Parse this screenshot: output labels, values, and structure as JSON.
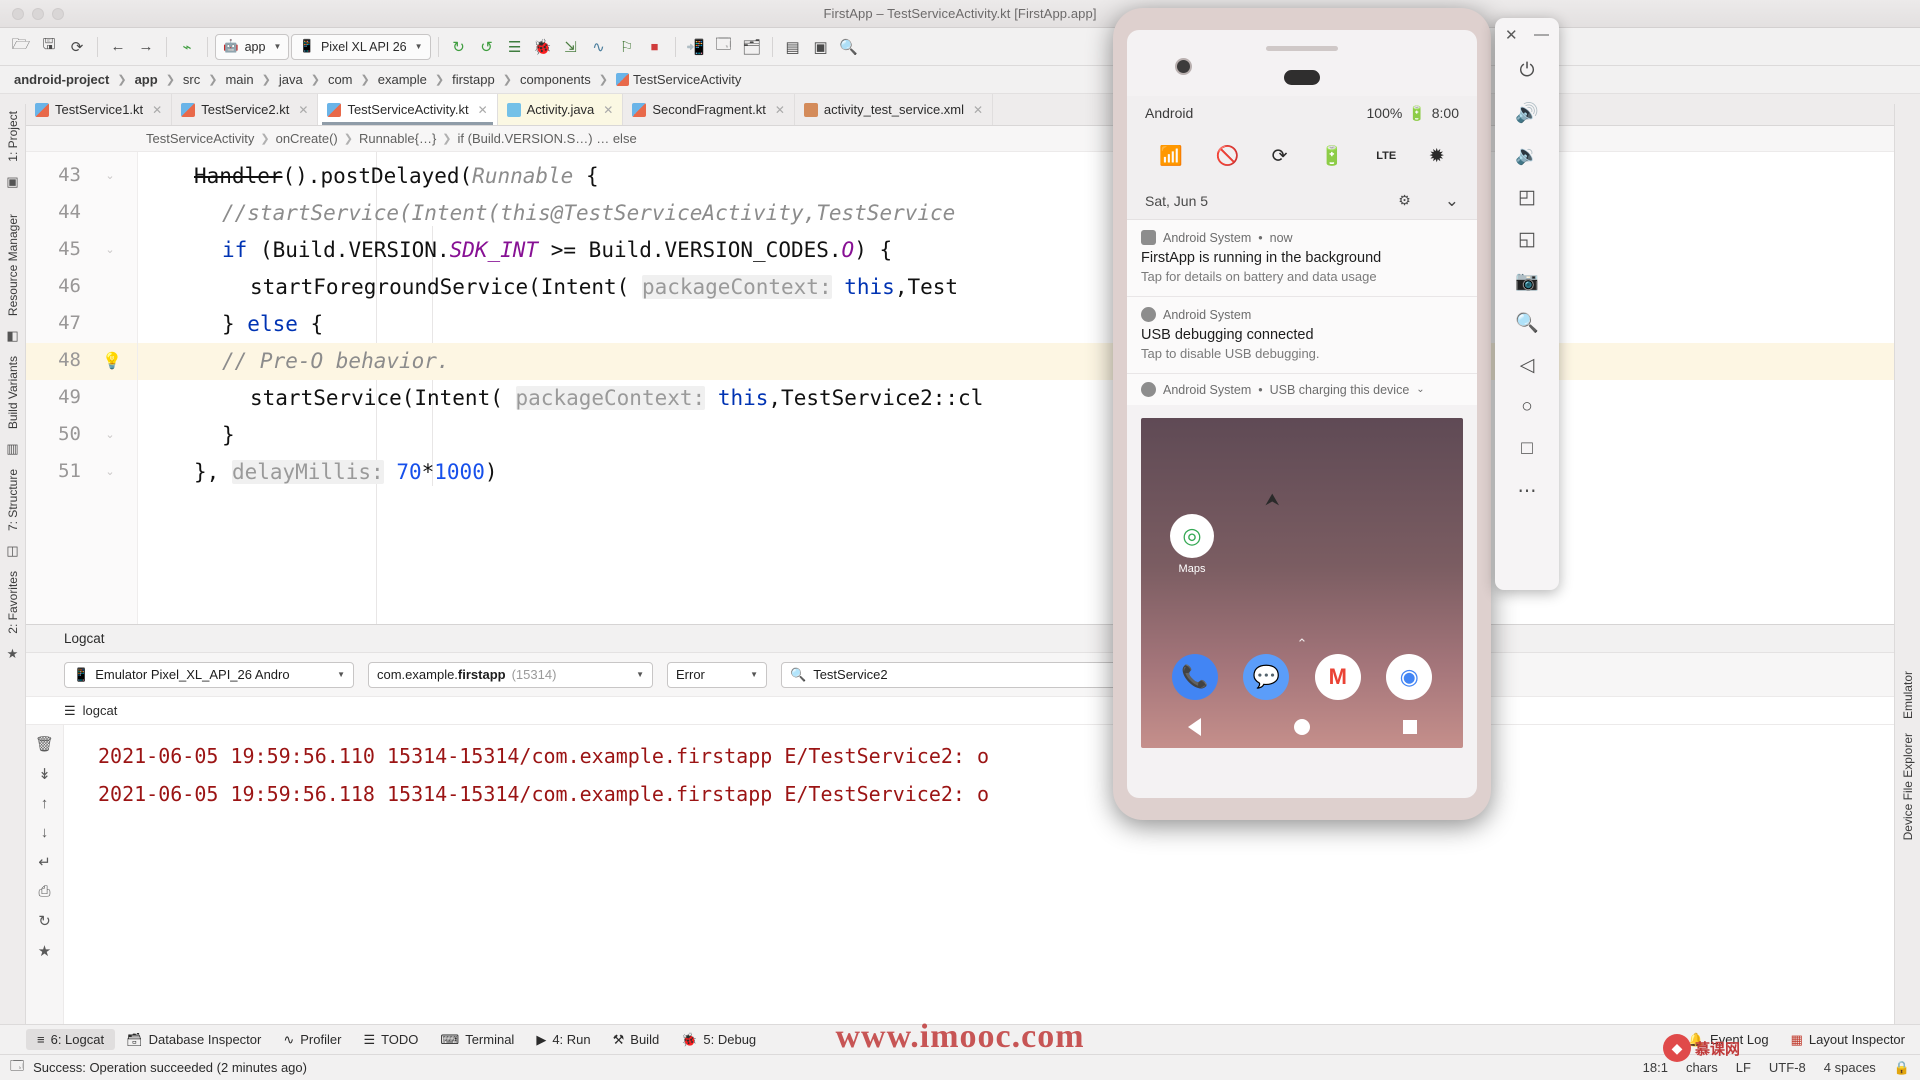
{
  "window": {
    "title": "FirstApp – TestServiceActivity.kt [FirstApp.app]"
  },
  "toolbar": {
    "icons": [
      {
        "name": "open-folder-icon",
        "glyph": "📂"
      },
      {
        "name": "save-all-icon",
        "glyph": "💾"
      },
      {
        "name": "sync-icon",
        "glyph": "↻"
      },
      {
        "name": "back-icon",
        "glyph": "←"
      },
      {
        "name": "forward-icon",
        "glyph": "→"
      },
      {
        "name": "build-hammer-icon",
        "glyph": "⚒"
      }
    ],
    "module_selector": "app",
    "device_selector": "Pixel XL API 26",
    "run_icons": [
      {
        "name": "run-icon",
        "glyph": "▶"
      },
      {
        "name": "apply-changes-icon",
        "glyph": "↻"
      },
      {
        "name": "apply-code-changes-icon",
        "glyph": "↺"
      },
      {
        "name": "run-with-coverage-icon",
        "glyph": "≡"
      },
      {
        "name": "debug-icon",
        "glyph": "🐞"
      },
      {
        "name": "attach-debugger-icon",
        "glyph": "⬇"
      },
      {
        "name": "profile-icon",
        "glyph": "∿"
      },
      {
        "name": "run-anything-icon",
        "glyph": "⚑"
      },
      {
        "name": "stop-icon",
        "glyph": "■"
      },
      {
        "name": "avd-manager-icon",
        "glyph": "📱"
      },
      {
        "name": "sdk-manager-icon",
        "glyph": "⚙"
      },
      {
        "name": "device-file-explorer-icon",
        "glyph": "🗂"
      },
      {
        "name": "layout-inspector-icon",
        "glyph": "▦"
      },
      {
        "name": "search-everywhere-icon",
        "glyph": "🔍"
      }
    ]
  },
  "breadcrumb": {
    "items": [
      {
        "label": "android-project",
        "bold": true
      },
      {
        "label": "app",
        "bold": true
      },
      {
        "label": "src",
        "bold": false
      },
      {
        "label": "main",
        "bold": false
      },
      {
        "label": "java",
        "bold": false
      },
      {
        "label": "com",
        "bold": false
      },
      {
        "label": "example",
        "bold": false
      },
      {
        "label": "firstapp",
        "bold": false
      },
      {
        "label": "components",
        "bold": false
      },
      {
        "label": "TestServiceActivity",
        "bold": false
      }
    ]
  },
  "tabs": [
    {
      "label": "TestService1.kt",
      "icon": "kotlin-file-icon",
      "type": "kt",
      "active": false
    },
    {
      "label": "TestService2.kt",
      "icon": "kotlin-file-icon",
      "type": "kt",
      "active": false
    },
    {
      "label": "TestServiceActivity.kt",
      "icon": "kotlin-file-icon",
      "type": "kt",
      "active": true
    },
    {
      "label": "Activity.java",
      "icon": "java-file-icon",
      "type": "java",
      "active": false
    },
    {
      "label": "SecondFragment.kt",
      "icon": "kotlin-file-icon",
      "type": "kt",
      "active": false
    },
    {
      "label": "activity_test_service.xml",
      "icon": "xml-file-icon",
      "type": "xml",
      "active": false
    }
  ],
  "structure_breadcrumb": [
    "TestServiceActivity",
    "onCreate()",
    "Runnable{…}",
    "if (Build.VERSION.S…) … else"
  ],
  "editor": {
    "lines": [
      {
        "number": "43",
        "indent": 0,
        "highlight": false,
        "fold": true,
        "bulb": false,
        "segments": [
          {
            "t": "Handler",
            "c": "strike"
          },
          {
            "t": "().postDelayed(",
            "c": ""
          },
          {
            "t": "Runnable",
            "c": "cm"
          },
          {
            "t": " {",
            "c": ""
          }
        ]
      },
      {
        "number": "44",
        "indent": 1,
        "highlight": false,
        "fold": false,
        "bulb": false,
        "segments": [
          {
            "t": "//startService(Intent(this@TestServiceActivity,TestService",
            "c": "cm"
          }
        ]
      },
      {
        "number": "45",
        "indent": 1,
        "highlight": false,
        "fold": true,
        "bulb": false,
        "segments": [
          {
            "t": "if",
            "c": "kw"
          },
          {
            "t": " (Build.VERSION.",
            "c": ""
          },
          {
            "t": "SDK_INT",
            "c": "const"
          },
          {
            "t": " >= Build.VERSION_CODES.",
            "c": ""
          },
          {
            "t": "O",
            "c": "const"
          },
          {
            "t": ") {",
            "c": ""
          }
        ]
      },
      {
        "number": "46",
        "indent": 2,
        "highlight": false,
        "fold": false,
        "bulb": false,
        "segments": [
          {
            "t": "startForegroundService(Intent( ",
            "c": ""
          },
          {
            "t": "packageContext:",
            "c": "hint"
          },
          {
            "t": " ",
            "c": ""
          },
          {
            "t": "this",
            "c": "kw"
          },
          {
            "t": ",Test",
            "c": ""
          }
        ]
      },
      {
        "number": "47",
        "indent": 1,
        "highlight": false,
        "fold": false,
        "bulb": false,
        "segments": [
          {
            "t": "} ",
            "c": ""
          },
          {
            "t": "else",
            "c": "kw"
          },
          {
            "t": " {",
            "c": ""
          }
        ]
      },
      {
        "number": "48",
        "indent": 1,
        "highlight": true,
        "fold": false,
        "bulb": true,
        "segments": [
          {
            "t": "// Pre-O behavior.",
            "c": "cm"
          }
        ]
      },
      {
        "number": "49",
        "indent": 2,
        "highlight": false,
        "fold": false,
        "bulb": false,
        "segments": [
          {
            "t": "startService(Intent( ",
            "c": ""
          },
          {
            "t": "packageContext:",
            "c": "hint"
          },
          {
            "t": " ",
            "c": ""
          },
          {
            "t": "this",
            "c": "kw"
          },
          {
            "t": ",TestService2::cl",
            "c": ""
          }
        ]
      },
      {
        "number": "50",
        "indent": 1,
        "highlight": false,
        "fold": true,
        "bulb": false,
        "segments": [
          {
            "t": "}",
            "c": ""
          }
        ]
      },
      {
        "number": "51",
        "indent": 0,
        "highlight": false,
        "fold": true,
        "bulb": false,
        "segments": [
          {
            "t": "}, ",
            "c": ""
          },
          {
            "t": "delayMillis:",
            "c": "hint"
          },
          {
            "t": " ",
            "c": ""
          },
          {
            "t": "70",
            "c": "num"
          },
          {
            "t": "*",
            "c": ""
          },
          {
            "t": "1000",
            "c": "num"
          },
          {
            "t": ")",
            "c": ""
          }
        ]
      }
    ]
  },
  "logcat": {
    "panel_title": "Logcat",
    "device": "Emulator Pixel_XL_API_26 Andro",
    "process": "com.example.firstapp",
    "process_pid": "(15314)",
    "level": "Error",
    "search_value": "TestService2",
    "search_placeholder": "Search",
    "sub_label": "logcat",
    "tool_icons": [
      {
        "name": "clear-logcat-icon",
        "glyph": "🗑"
      },
      {
        "name": "scroll-to-end-icon",
        "glyph": "↡"
      },
      {
        "name": "up-arrow-icon",
        "glyph": "↑"
      },
      {
        "name": "down-arrow-icon",
        "glyph": "↓"
      },
      {
        "name": "soft-wrap-icon",
        "glyph": "↵"
      },
      {
        "name": "print-icon",
        "glyph": "⎙"
      },
      {
        "name": "restart-icon",
        "glyph": "↻"
      },
      {
        "name": "settings-star-icon",
        "glyph": "★"
      }
    ],
    "entries": [
      "2021-06-05 19:59:56.110 15314-15314/com.example.firstapp E/TestService2: o",
      "2021-06-05 19:59:56.118 15314-15314/com.example.firstapp E/TestService2: o"
    ]
  },
  "bottom_tools": [
    {
      "label": "6: Logcat",
      "icon": "logcat-icon",
      "glyph": "≡",
      "active": true,
      "mnemonic": "6"
    },
    {
      "label": "Database Inspector",
      "icon": "database-icon",
      "glyph": "🗃",
      "active": false
    },
    {
      "label": "Profiler",
      "icon": "profiler-icon",
      "glyph": "∿",
      "active": false
    },
    {
      "label": "TODO",
      "icon": "todo-icon",
      "glyph": "☰",
      "active": false
    },
    {
      "label": "Terminal",
      "icon": "terminal-icon",
      "glyph": "⌨",
      "active": false
    },
    {
      "label": "4: Run",
      "icon": "run-icon",
      "glyph": "▶",
      "active": false,
      "mnemonic": "4"
    },
    {
      "label": "Build",
      "icon": "build-icon",
      "glyph": "⚒",
      "active": false
    },
    {
      "label": "5: Debug",
      "icon": "debug-icon",
      "glyph": "🐞",
      "active": false,
      "mnemonic": "5"
    }
  ],
  "bottom_right_tools": [
    {
      "label": "Event Log",
      "icon": "event-log-icon",
      "glyph": "🔔"
    },
    {
      "label": "Layout Inspector",
      "icon": "layout-inspector-icon",
      "glyph": "▦"
    }
  ],
  "left_rail": [
    {
      "label": "1: Project",
      "name": "sidebar-item-project"
    },
    {
      "label": "Resource Manager",
      "name": "sidebar-item-resource-manager"
    },
    {
      "label": "Build Variants",
      "name": "sidebar-item-build-variants"
    },
    {
      "label": "7: Structure",
      "name": "sidebar-item-structure"
    },
    {
      "label": "2: Favorites",
      "name": "sidebar-item-favorites"
    }
  ],
  "right_rail": [
    {
      "label": "Emulator",
      "name": "sidebar-item-emulator"
    },
    {
      "label": "Device File Explorer",
      "name": "sidebar-item-device-file-explorer"
    }
  ],
  "status_bar": {
    "message": "Success: Operation succeeded (2 minutes ago)",
    "caret": "18:1",
    "chars": "chars",
    "line_ending": "LF",
    "encoding": "UTF-8",
    "indent": "4 spaces"
  },
  "emulator": {
    "status": {
      "carrier": "Android",
      "battery": "100%",
      "time": "8:00"
    },
    "quick_settings": [
      {
        "name": "wifi-off-icon",
        "glyph": "📶"
      },
      {
        "name": "do-not-disturb-icon",
        "glyph": "🚫"
      },
      {
        "name": "auto-rotate-icon",
        "glyph": "⟳"
      },
      {
        "name": "battery-saver-icon",
        "glyph": "🔋"
      },
      {
        "name": "mobile-data-lte-icon",
        "glyph": "LTE"
      },
      {
        "name": "flashlight-icon",
        "glyph": "✹"
      }
    ],
    "date": "Sat, Jun 5",
    "date_actions": [
      {
        "name": "settings-gear-icon",
        "glyph": "⚙"
      },
      {
        "name": "expand-chevron-icon",
        "glyph": "⌄"
      }
    ],
    "notifications": [
      {
        "app": "Android System",
        "time": "now",
        "title": "FirstApp is running in the background",
        "subtitle": "Tap for details on battery and data usage",
        "icon": "chart-icon"
      },
      {
        "app": "Android System",
        "time": "",
        "title": "USB debugging connected",
        "subtitle": "Tap to disable USB debugging.",
        "icon": "circle-icon"
      }
    ],
    "collapsed_notification": {
      "app": "Android System",
      "detail": "USB charging this device",
      "icon": "circle-icon"
    },
    "home": {
      "apps": [
        {
          "label": "Maps",
          "icon": "maps-icon",
          "glyph": "📍"
        }
      ],
      "dock": [
        {
          "name": "phone-icon",
          "glyph": "📞",
          "color": "#3b82f6"
        },
        {
          "name": "messages-icon",
          "glyph": "💬",
          "color": "#5b9df9"
        },
        {
          "name": "gmail-icon",
          "glyph": "M",
          "color": "#ffffff"
        },
        {
          "name": "chrome-icon",
          "glyph": "◉",
          "color": "#ffffff"
        }
      ],
      "nav": [
        {
          "name": "nav-back-icon"
        },
        {
          "name": "nav-home-icon"
        },
        {
          "name": "nav-recents-icon"
        }
      ]
    },
    "side_toolbar": [
      {
        "name": "close-icon",
        "glyph": "✕"
      },
      {
        "name": "minimize-icon",
        "glyph": "—"
      },
      {
        "name": "power-icon",
        "glyph": "⏻"
      },
      {
        "name": "volume-up-icon",
        "glyph": "🔊"
      },
      {
        "name": "volume-down-icon",
        "glyph": "🔉"
      },
      {
        "name": "rotate-left-icon",
        "glyph": "◰"
      },
      {
        "name": "rotate-right-icon",
        "glyph": "◱"
      },
      {
        "name": "screenshot-icon",
        "glyph": "📷"
      },
      {
        "name": "zoom-icon",
        "glyph": "🔍"
      },
      {
        "name": "back-icon",
        "glyph": "◁"
      },
      {
        "name": "home-icon",
        "glyph": "○"
      },
      {
        "name": "overview-icon",
        "glyph": "□"
      },
      {
        "name": "more-icon",
        "glyph": "…"
      }
    ]
  },
  "watermark": {
    "url": "www.imooc.com",
    "badge": "慕课网"
  }
}
